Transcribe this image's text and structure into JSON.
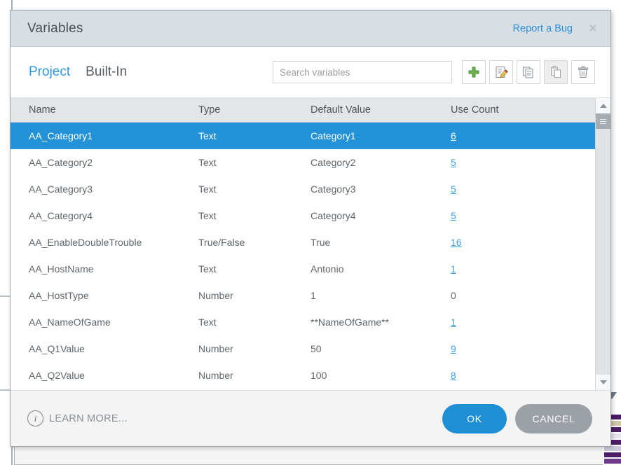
{
  "window": {
    "title": "Variables",
    "report_bug_label": "Report a Bug",
    "close_label": "×"
  },
  "toolbar": {
    "tabs": [
      {
        "label": "Project",
        "active": true
      },
      {
        "label": "Built-In",
        "active": false
      }
    ],
    "search": {
      "value": "",
      "placeholder": "Search variables"
    },
    "buttons": [
      {
        "name": "add-variable-button",
        "icon": "plus-icon",
        "disabled": false
      },
      {
        "name": "edit-variable-button",
        "icon": "edit-document-icon",
        "disabled": false
      },
      {
        "name": "copy-variable-button",
        "icon": "copy-icon",
        "disabled": false
      },
      {
        "name": "paste-variable-button",
        "icon": "paste-clipboard-icon",
        "disabled": true
      },
      {
        "name": "delete-variable-button",
        "icon": "trash-icon",
        "disabled": false
      }
    ]
  },
  "table": {
    "columns": [
      "Name",
      "Type",
      "Default Value",
      "Use Count"
    ],
    "rows": [
      {
        "name": "AA_Category1",
        "type": "Text",
        "value": "Category1",
        "count": "6",
        "link": true,
        "selected": true
      },
      {
        "name": "AA_Category2",
        "type": "Text",
        "value": "Category2",
        "count": "5",
        "link": true,
        "selected": false
      },
      {
        "name": "AA_Category3",
        "type": "Text",
        "value": "Category3",
        "count": "5",
        "link": true,
        "selected": false
      },
      {
        "name": "AA_Category4",
        "type": "Text",
        "value": "Category4",
        "count": "5",
        "link": true,
        "selected": false
      },
      {
        "name": "AA_EnableDoubleTrouble",
        "type": "True/False",
        "value": "True",
        "count": "16",
        "link": true,
        "selected": false
      },
      {
        "name": "AA_HostName",
        "type": "Text",
        "value": "Antonio",
        "count": "1",
        "link": true,
        "selected": false
      },
      {
        "name": "AA_HostType",
        "type": "Number",
        "value": "1",
        "count": "0",
        "link": false,
        "selected": false
      },
      {
        "name": "AA_NameOfGame",
        "type": "Text",
        "value": "**NameOfGame**",
        "count": "1",
        "link": true,
        "selected": false
      },
      {
        "name": "AA_Q1Value",
        "type": "Number",
        "value": "50",
        "count": "9",
        "link": true,
        "selected": false
      },
      {
        "name": "AA_Q2Value",
        "type": "Number",
        "value": "100",
        "count": "8",
        "link": true,
        "selected": false
      }
    ]
  },
  "footer": {
    "learn_more_label": "LEARN MORE...",
    "ok_label": "OK",
    "cancel_label": "CANCEL"
  },
  "colors": {
    "titlebar": "#d7dee4",
    "accent_blue": "#2392d8",
    "link_blue": "#3196dd",
    "ok_button": "#1e8fd5",
    "cancel_button": "#9ba1a6",
    "header_row": "#e2e6e9",
    "footer_bg": "#f4f4f4"
  }
}
